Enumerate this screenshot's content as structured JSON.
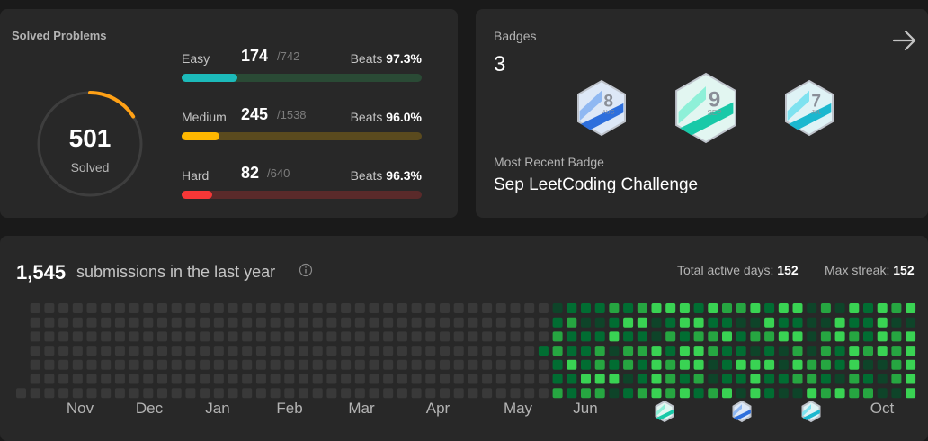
{
  "solved": {
    "title": "Solved Problems",
    "total": "501",
    "total_label": "Solved",
    "progress_fraction": 0.16,
    "difficulties": [
      {
        "label": "Easy",
        "count": "174",
        "total": "/742",
        "beats_label": "Beats",
        "beats": "97.3%",
        "fraction": 0.234,
        "color": "#1cbaba",
        "track": "#2a4a35"
      },
      {
        "label": "Medium",
        "count": "245",
        "total": "/1538",
        "beats_label": "Beats",
        "beats": "96.0%",
        "fraction": 0.159,
        "color": "#ffb700",
        "track": "#5a4a1e"
      },
      {
        "label": "Hard",
        "count": "82",
        "total": "/640",
        "beats_label": "Beats",
        "beats": "96.3%",
        "fraction": 0.128,
        "color": "#f63737",
        "track": "#5a2a2a"
      }
    ]
  },
  "badges": {
    "title": "Badges",
    "count": "3",
    "items": [
      {
        "number": "8",
        "month": "AUG",
        "palette": "blue"
      },
      {
        "number": "9",
        "month": "SEP",
        "palette": "teal"
      },
      {
        "number": "7",
        "month": "JUL",
        "palette": "cyan"
      }
    ],
    "recent_label": "Most Recent Badge",
    "recent_name": "Sep LeetCoding Challenge"
  },
  "submissions": {
    "count": "1,545",
    "label": "submissions in the last year",
    "active_days_label": "Total active days:",
    "active_days": "152",
    "max_streak_label": "Max streak:",
    "max_streak": "152",
    "months": [
      "Nov",
      "Dec",
      "Jan",
      "Feb",
      "Mar",
      "Apr",
      "May",
      "Jun",
      "",
      "",
      "",
      "Oct"
    ],
    "month_badges": [
      null,
      null,
      null,
      null,
      null,
      null,
      null,
      null,
      "teal",
      "blue",
      "cyan",
      null
    ]
  },
  "colors": {
    "empty_cell": "#393939",
    "green_levels": [
      "#0e4429",
      "#016d32",
      "#26a641",
      "#39d353"
    ]
  }
}
